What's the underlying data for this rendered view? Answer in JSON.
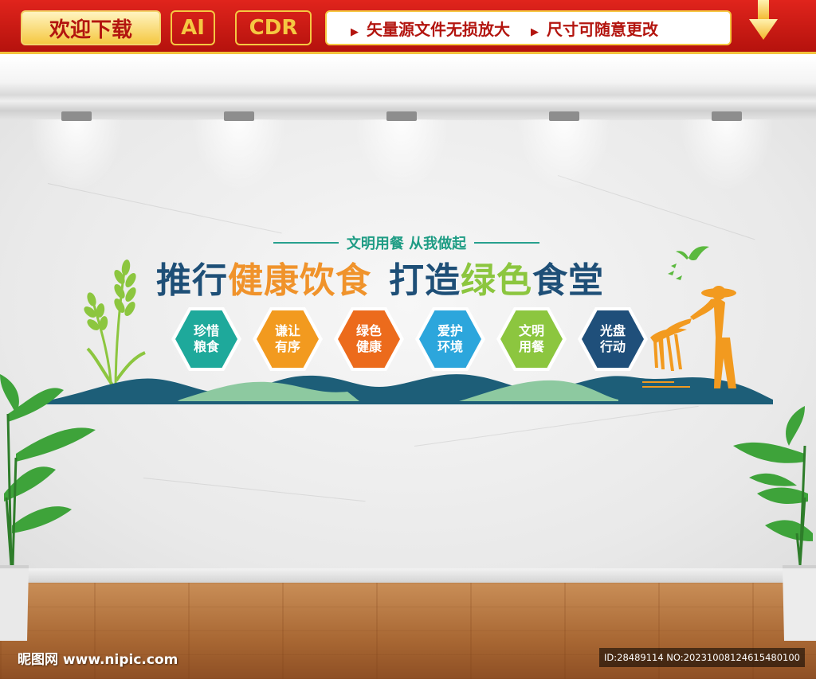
{
  "banner": {
    "download_label": "欢迎下载",
    "format_ai": "AI",
    "format_cdr": "CDR",
    "feature_1": "矢量源文件无损放大",
    "feature_2": "尺寸可随意更改",
    "feature_marker": "▶",
    "down_arrow_icon": "arrow-down-icon"
  },
  "wall": {
    "subtitle": "文明用餐  从我做起",
    "headline": {
      "part1": "推行",
      "part2": "健康饮食",
      "part3": "打造",
      "part4": "绿色",
      "part5": "食堂"
    },
    "hexagons": [
      {
        "line1": "珍惜",
        "line2": "粮食",
        "color": "#1ea99b"
      },
      {
        "line1": "谦让",
        "line2": "有序",
        "color": "#f29a1f"
      },
      {
        "line1": "绿色",
        "line2": "健康",
        "color": "#ec6b1c"
      },
      {
        "line1": "爱护",
        "line2": "环境",
        "color": "#2ca6dc"
      },
      {
        "line1": "文明",
        "line2": "用餐",
        "color": "#8cc63f"
      },
      {
        "line1": "光盘",
        "line2": "行动",
        "color": "#1f4f7a"
      }
    ]
  },
  "colors": {
    "banner_red": "#c81a14",
    "gold": "#f5c842",
    "dark_blue": "#1e4f77",
    "orange": "#f0932b",
    "green": "#8cc63f",
    "teal": "#1e9c84"
  },
  "watermark": {
    "site": "昵图网 www.nipic.com",
    "id": "ID:28489114 NO:20231008124615480100"
  }
}
